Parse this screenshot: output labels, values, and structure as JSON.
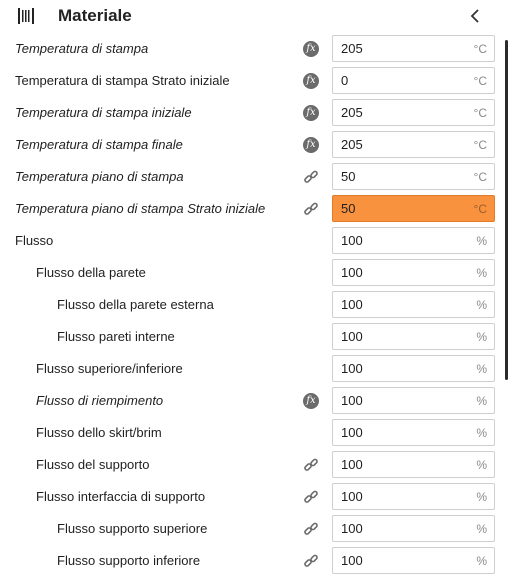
{
  "header": {
    "title": "Materiale"
  },
  "rows": [
    {
      "label": "Temperatura di stampa",
      "italic": true,
      "indent": 0,
      "icon": "fx",
      "value": "205",
      "unit": "°C",
      "warn": false
    },
    {
      "label": "Temperatura di stampa Strato iniziale",
      "italic": false,
      "indent": 0,
      "icon": "fx",
      "value": "0",
      "unit": "°C",
      "warn": false
    },
    {
      "label": "Temperatura di stampa iniziale",
      "italic": true,
      "indent": 0,
      "icon": "fx",
      "value": "205",
      "unit": "°C",
      "warn": false
    },
    {
      "label": "Temperatura di stampa finale",
      "italic": true,
      "indent": 0,
      "icon": "fx",
      "value": "205",
      "unit": "°C",
      "warn": false
    },
    {
      "label": "Temperatura piano di stampa",
      "italic": true,
      "indent": 0,
      "icon": "link",
      "value": "50",
      "unit": "°C",
      "warn": false
    },
    {
      "label": "Temperatura piano di stampa Strato iniziale",
      "italic": true,
      "indent": 0,
      "icon": "link",
      "value": "50",
      "unit": "°C",
      "warn": true
    },
    {
      "label": "Flusso",
      "italic": false,
      "indent": 0,
      "icon": "",
      "value": "100",
      "unit": "%",
      "warn": false
    },
    {
      "label": "Flusso della parete",
      "italic": false,
      "indent": 1,
      "icon": "",
      "value": "100",
      "unit": "%",
      "warn": false
    },
    {
      "label": "Flusso della parete esterna",
      "italic": false,
      "indent": 2,
      "icon": "",
      "value": "100",
      "unit": "%",
      "warn": false
    },
    {
      "label": "Flusso pareti interne",
      "italic": false,
      "indent": 2,
      "icon": "",
      "value": "100",
      "unit": "%",
      "warn": false
    },
    {
      "label": "Flusso superiore/inferiore",
      "italic": false,
      "indent": 1,
      "icon": "",
      "value": "100",
      "unit": "%",
      "warn": false
    },
    {
      "label": "Flusso di riempimento",
      "italic": true,
      "indent": 1,
      "icon": "fx",
      "value": "100",
      "unit": "%",
      "warn": false
    },
    {
      "label": "Flusso dello skirt/brim",
      "italic": false,
      "indent": 1,
      "icon": "",
      "value": "100",
      "unit": "%",
      "warn": false
    },
    {
      "label": "Flusso del supporto",
      "italic": false,
      "indent": 1,
      "icon": "link",
      "value": "100",
      "unit": "%",
      "warn": false
    },
    {
      "label": "Flusso interfaccia di supporto",
      "italic": false,
      "indent": 1,
      "icon": "link",
      "value": "100",
      "unit": "%",
      "warn": false
    },
    {
      "label": "Flusso supporto superiore",
      "italic": false,
      "indent": 2,
      "icon": "link",
      "value": "100",
      "unit": "%",
      "warn": false
    },
    {
      "label": "Flusso supporto inferiore",
      "italic": false,
      "indent": 2,
      "icon": "link",
      "value": "100",
      "unit": "%",
      "warn": false
    }
  ],
  "colors": {
    "warning_field": "#f9923f"
  }
}
